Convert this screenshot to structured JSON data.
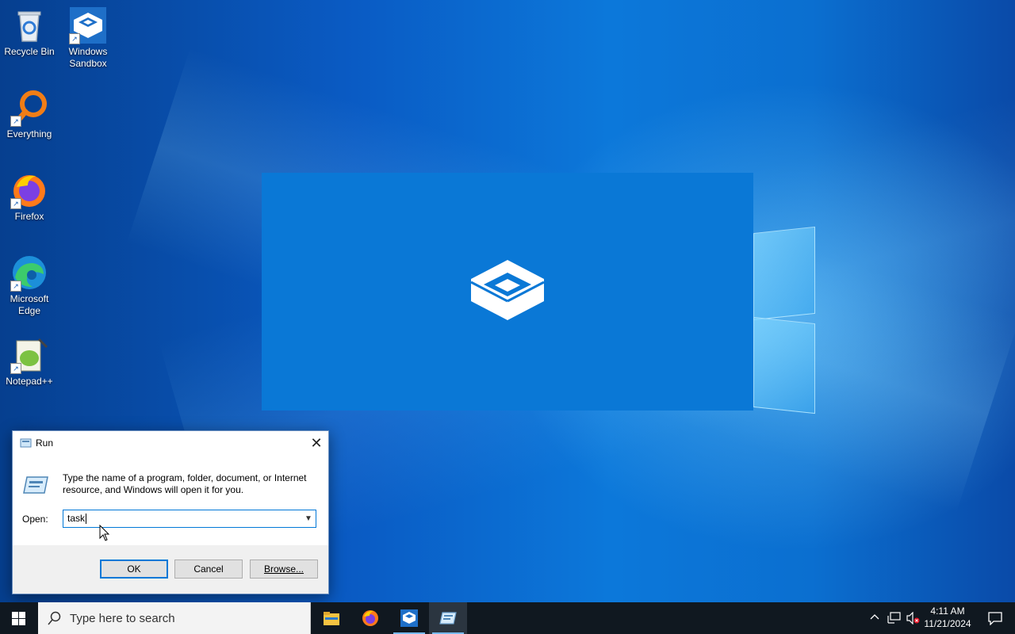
{
  "desktop": {
    "icons": [
      {
        "label": "Recycle Bin"
      },
      {
        "label": "Windows Sandbox"
      },
      {
        "label": "Everything"
      },
      {
        "label": "Firefox"
      },
      {
        "label": "Microsoft Edge"
      },
      {
        "label": "Notepad++"
      }
    ]
  },
  "run_dialog": {
    "title": "Run",
    "description": "Type the name of a program, folder, document, or Internet resource, and Windows will open it for you.",
    "open_label": "Open:",
    "open_value": "task",
    "ok_label": "OK",
    "cancel_label": "Cancel",
    "browse_label": "Browse..."
  },
  "taskbar": {
    "search_placeholder": "Type here to search",
    "apps": [
      {
        "icon": "file-explorer-icon"
      },
      {
        "icon": "firefox-icon"
      },
      {
        "icon": "windows-sandbox-icon"
      },
      {
        "icon": "run-icon"
      }
    ],
    "clock_time": "4:11 AM",
    "clock_date": "11/21/2024"
  },
  "colors": {
    "accent": "#0078d7",
    "taskbar": "#101820",
    "splash": "#0a78d6"
  }
}
